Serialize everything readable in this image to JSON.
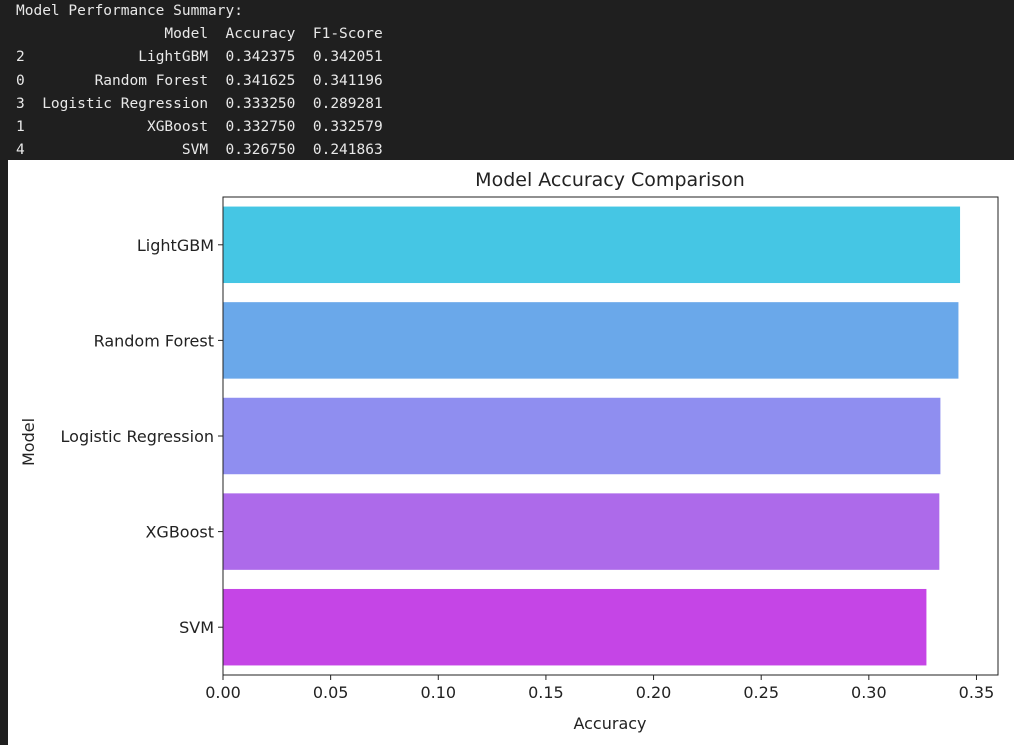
{
  "terminal": {
    "title": "Model Performance Summary:",
    "columns": [
      "",
      "Model",
      "Accuracy",
      "F1-Score"
    ],
    "rows": [
      [
        "2",
        "LightGBM",
        "0.342375",
        "0.342051"
      ],
      [
        "0",
        "Random Forest",
        "0.341625",
        "0.341196"
      ],
      [
        "3",
        "Logistic Regression",
        "0.333250",
        "0.289281"
      ],
      [
        "1",
        "XGBoost",
        "0.332750",
        "0.332579"
      ],
      [
        "4",
        "SVM",
        "0.326750",
        "0.241863"
      ]
    ]
  },
  "chart_data": {
    "type": "bar",
    "orientation": "horizontal",
    "title": "Model Accuracy Comparison",
    "xlabel": "Accuracy",
    "ylabel": "Model",
    "categories": [
      "LightGBM",
      "Random Forest",
      "Logistic Regression",
      "XGBoost",
      "SVM"
    ],
    "values": [
      0.342375,
      0.341625,
      0.33325,
      0.33275,
      0.32675
    ],
    "colors": [
      "#45c6e4",
      "#6aa8ea",
      "#8f8ef0",
      "#ad6aea",
      "#c545e6"
    ],
    "xlim": [
      0,
      0.36
    ],
    "xticks": [
      0.0,
      0.05,
      0.1,
      0.15,
      0.2,
      0.25,
      0.3,
      0.35
    ],
    "xtick_labels": [
      "0.00",
      "0.05",
      "0.10",
      "0.15",
      "0.20",
      "0.25",
      "0.30",
      "0.35"
    ],
    "grid": false,
    "legend": "none"
  }
}
